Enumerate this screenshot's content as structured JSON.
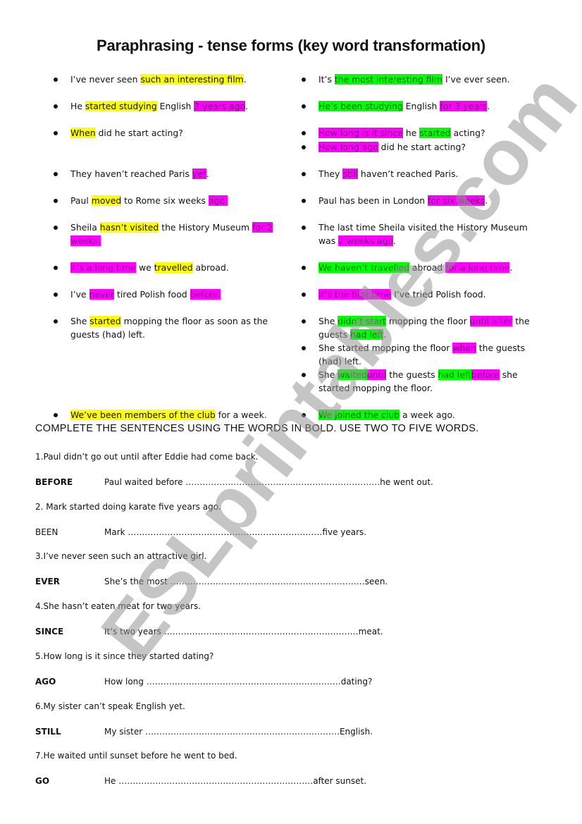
{
  "title": "Paraphrasing -  tense forms (key word transformation)",
  "highlight_colors": {
    "yellow": "#ffff00",
    "magenta": "#ff00ff",
    "green": "#00ff00"
  },
  "pairs": [
    {
      "left": [
        [
          {
            "t": "I’ve never seen "
          },
          {
            "t": "such an interesting film",
            "h": "y"
          },
          {
            "t": "."
          }
        ]
      ],
      "right": [
        [
          {
            "t": "It’s "
          },
          {
            "t": "the most interesting film",
            "h": "g"
          },
          {
            "t": " I’ve ever seen."
          }
        ]
      ]
    },
    {
      "left": [
        [
          {
            "t": "He "
          },
          {
            "t": "started studying",
            "h": "y"
          },
          {
            "t": " English "
          },
          {
            "t": "3 years ago",
            "h": "m"
          },
          {
            "t": "."
          }
        ]
      ],
      "right": [
        [
          {
            "t": "He’s been studying",
            "h": "g"
          },
          {
            "t": " English "
          },
          {
            "t": "for 3 years",
            "h": "m"
          },
          {
            "t": "."
          }
        ]
      ]
    },
    {
      "left": [
        [
          {
            "t": "When",
            "h": "y"
          },
          {
            "t": " did he start acting?"
          }
        ]
      ],
      "right": [
        [
          {
            "t": "How long is it since",
            "h": "m"
          },
          {
            "t": " he "
          },
          {
            "t": "started",
            "h": "g"
          },
          {
            "t": " acting?"
          }
        ],
        [
          {
            "t": "How long ago",
            "h": "m"
          },
          {
            "t": " did he start acting?"
          }
        ]
      ]
    },
    {
      "left": [
        [
          {
            "t": "They haven’t reached Paris "
          },
          {
            "t": "yet",
            "h": "m"
          },
          {
            "t": "."
          }
        ]
      ],
      "right": [
        [
          {
            "t": "They "
          },
          {
            "t": "still",
            "h": "m"
          },
          {
            "t": " haven’t reached Paris."
          }
        ]
      ]
    },
    {
      "left": [
        [
          {
            "t": "Paul "
          },
          {
            "t": "moved",
            "h": "y"
          },
          {
            "t": " to Rome six weeks  "
          },
          {
            "t": "ago.",
            "h": "m"
          }
        ]
      ],
      "right": [
        [
          {
            "t": "Paul has been in London "
          },
          {
            "t": "for six weeks",
            "h": "m"
          },
          {
            "t": "."
          }
        ]
      ]
    },
    {
      "left": [
        [
          {
            "t": "Sheila "
          },
          {
            "t": "hasn’t visited",
            "h": "y"
          },
          {
            "t": " the History Museum  "
          },
          {
            "t": "for 2 weeks.",
            "h": "m"
          }
        ]
      ],
      "right": [
        [
          {
            "t": "The last time Sheila visited the History Museum was "
          },
          {
            "t": "2 weeks ago",
            "h": "m"
          },
          {
            "t": "."
          }
        ]
      ]
    },
    {
      "left": [
        [
          {
            "t": "It’s a long time",
            "h": "m"
          },
          {
            "t": " we "
          },
          {
            "t": "travelled",
            "h": "y"
          },
          {
            "t": " abroad."
          }
        ]
      ],
      "right": [
        [
          {
            "t": "We haven’t travelled",
            "h": "g"
          },
          {
            "t": " abroad "
          },
          {
            "t": "for a long time",
            "h": "m"
          },
          {
            "t": "."
          }
        ]
      ]
    },
    {
      "left": [
        [
          {
            "t": "I’ve "
          },
          {
            "t": "never",
            "h": "m"
          },
          {
            "t": " tired Polish food "
          },
          {
            "t": "before.",
            "h": "m"
          }
        ]
      ],
      "right": [
        [
          {
            "t": "It’s the first time",
            "h": "m"
          },
          {
            "t": " I’ve tried Polish food."
          }
        ]
      ]
    },
    {
      "left": [
        [
          {
            "t": "She "
          },
          {
            "t": "started",
            "h": "y"
          },
          {
            "t": " mopping the floor as soon as the guests (had) left."
          }
        ]
      ],
      "right": [
        [
          {
            "t": "She "
          },
          {
            "t": "didn’t start",
            "h": "g"
          },
          {
            "t": " mopping the floor "
          },
          {
            "t": "until after",
            "h": "m"
          },
          {
            "t": " the guests "
          },
          {
            "t": "had left",
            "h": "g"
          },
          {
            "t": "."
          }
        ],
        [
          {
            "t": "She started mopping the floor "
          },
          {
            "t": "when",
            "h": "m"
          },
          {
            "t": " the guests (had) left."
          }
        ],
        [
          {
            "t": "She "
          },
          {
            "t": "waited",
            "h": "g"
          },
          {
            "t": "until",
            "h": "m"
          },
          {
            "t": " the guests "
          },
          {
            "t": "had left",
            "h": "g"
          },
          {
            "t": "before",
            "h": "m"
          },
          {
            "t": " she started mopping the floor."
          }
        ]
      ]
    },
    {
      "left": [
        [
          {
            "t": "We’ve been members of the club",
            "h": "y"
          },
          {
            "t": " for a week."
          }
        ]
      ],
      "right": [
        [
          {
            "t": "We joined the club",
            "h": "g"
          },
          {
            "t": " a week ago."
          }
        ]
      ]
    }
  ],
  "instruction": "COMPLETE THE SENTENCES USING THE WORDS IN BOLD. USE TWO TO FIVE WORDS.",
  "exercises": [
    {
      "sentence": "1.Paul didn’t go out until after Eddie had come back.",
      "keyword": "BEFORE",
      "bold": true,
      "answer": "Paul waited before ……………………………………………………………he went out."
    },
    {
      "sentence": "2. Mark started doing karate five years ago.",
      "keyword": "BEEN",
      "bold": false,
      "answer": "Mark ……………………………………………………………five years."
    },
    {
      "sentence": "3.I’ve never seen such an attractive girl.",
      "keyword": "EVER",
      "bold": true,
      "answer": "She’s the most ……………………………………………………………seen."
    },
    {
      "sentence": "4.She hasn’t eaten meat for two years.",
      "keyword": "SINCE",
      "bold": true,
      "answer": "It’s two years ……………………………………………………………meat."
    },
    {
      "sentence": "5.How long is it since they started dating?",
      "keyword": "AGO",
      "bold": true,
      "answer": "How long ……………………………………………………………dating?"
    },
    {
      "sentence": "6.My sister can’t speak English yet.",
      "keyword": "STILL",
      "bold": true,
      "answer": "My sister ……………………………………………………………English."
    },
    {
      "sentence": "7.He waited until sunset before he went to bed.",
      "keyword": "GO",
      "bold": true,
      "answer": "He ……………………………………………………………after sunset."
    }
  ],
  "watermark": "ESLprintables.com"
}
